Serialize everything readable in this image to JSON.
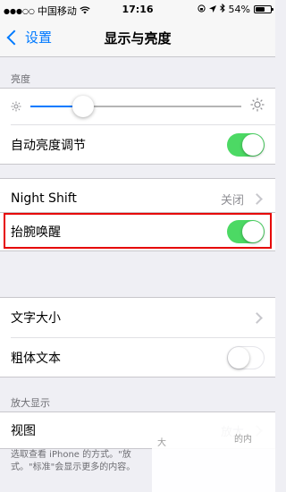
{
  "status": {
    "carrier": "中国移动",
    "time": "17:16",
    "battery": "54%",
    "battery_level": 0.54
  },
  "nav": {
    "back_label": "设置",
    "title": "显示与亮度"
  },
  "brightness": {
    "header": "亮度",
    "level": 0.25,
    "auto_label": "自动亮度调节",
    "auto_on": true
  },
  "night_shift": {
    "label": "Night Shift",
    "value": "关闭"
  },
  "raise_to_wake": {
    "label": "抬腕唤醒",
    "on": true
  },
  "text": {
    "size_label": "文字大小",
    "bold_label": "粗体文本",
    "bold_on": false
  },
  "zoom": {
    "header": "放大显示",
    "view_label": "视图",
    "view_value": "放大"
  },
  "footer": {
    "line1": "选取查看 iPhone 的方式。\"放",
    "line2": "式。\"标准\"会显示更多的内容。",
    "fragment1": "大",
    "fragment2": "的内"
  },
  "colors": {
    "accent": "#007aff",
    "switch_on": "#4cd964",
    "highlight": "#e60000"
  }
}
